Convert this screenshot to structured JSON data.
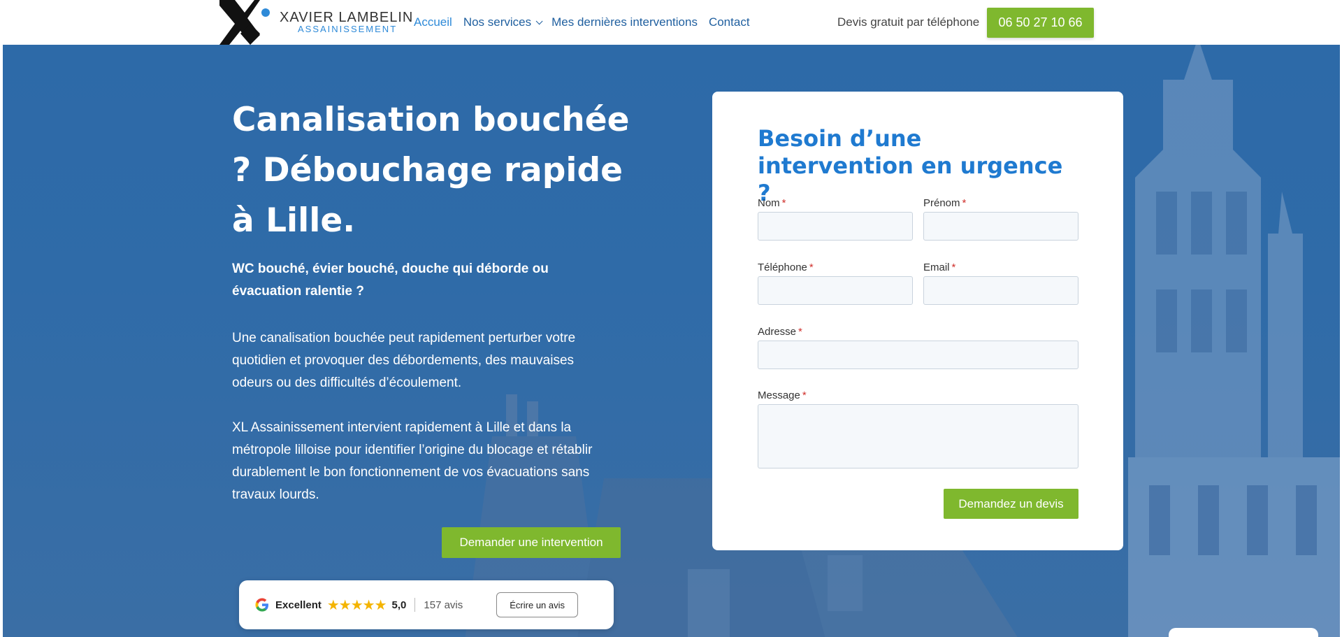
{
  "header": {
    "logo": {
      "name": "XAVIER LAMBELIN",
      "sub": "ASSAINISSEMENT"
    },
    "nav": [
      {
        "label": "Accueil",
        "active": true
      },
      {
        "label": "Nos services",
        "dropdown": true
      },
      {
        "label": "Mes dernières interventions"
      },
      {
        "label": "Contact"
      }
    ],
    "cta_text": "Devis gratuit par téléphone",
    "phone": "06 50 27 10 66"
  },
  "hero": {
    "title": "Canalisation bouchée ? Débouchage rapide à Lille.",
    "subtitle": "WC bouché, évier bouché, douche qui déborde ou évacuation ralentie ?",
    "paragraph1": "Une canalisation bouchée peut rapidement perturber votre quotidien et provoquer des débordements, des mauvaises odeurs ou des difficultés d’écoulement.",
    "paragraph2": "XL Assainissement intervient rapidement à Lille et dans la métropole lilloise pour identifier l’origine du blocage et rétablir durablement le bon fonctionnement de vos évacuations sans travaux lourds.",
    "button": "Demander une intervention"
  },
  "reviews": {
    "label": "Excellent",
    "stars": "★★★★★",
    "rating": "5,0",
    "count": "157 avis",
    "button": "Écrire un avis"
  },
  "form": {
    "title": "Besoin d’une intervention en urgence ?",
    "fields": {
      "nom": "Nom",
      "prenom": "Prénom",
      "telephone": "Téléphone",
      "email": "Email",
      "adresse": "Adresse",
      "message": "Message"
    },
    "required_mark": "*",
    "submit": "Demandez un devis"
  },
  "colors": {
    "accent_green": "#7fb82e",
    "brand_blue": "#1f7ad0",
    "hero_blue": "#2d6aa8",
    "star": "#f4b400",
    "required": "#d0312d"
  }
}
